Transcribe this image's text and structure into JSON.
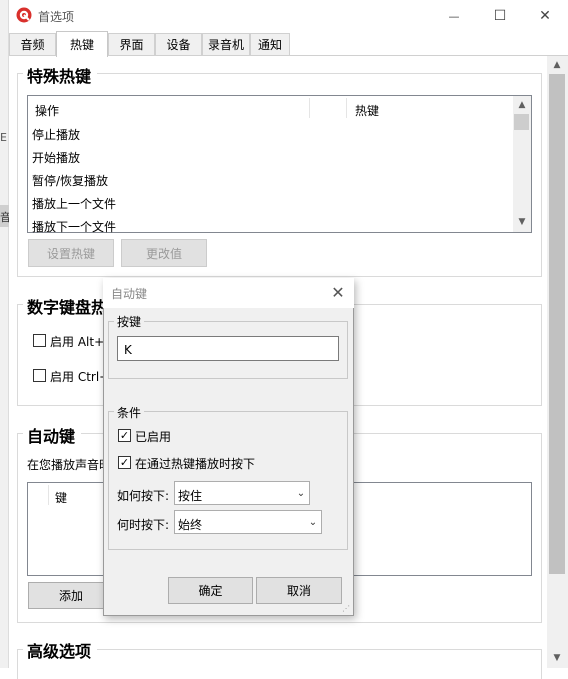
{
  "window": {
    "title": "首选项",
    "controls": {
      "minimize": "—",
      "maximize": "☐",
      "close": "✕"
    }
  },
  "tabs": [
    {
      "label": "音频",
      "active": false
    },
    {
      "label": "热键",
      "active": true
    },
    {
      "label": "界面",
      "active": false
    },
    {
      "label": "设备",
      "active": false
    },
    {
      "label": "录音机",
      "active": false
    },
    {
      "label": "通知",
      "active": false
    }
  ],
  "special_hotkeys": {
    "title": "特殊热键",
    "columns": [
      "操作",
      "热键"
    ],
    "rows": [
      "停止播放",
      "开始播放",
      "暂停/恢复播放",
      "播放上一个文件",
      "播放下一个文件"
    ],
    "set_button": "设置热键",
    "change_button": "更改值"
  },
  "numpad_hotkeys": {
    "title": "数字键盘热",
    "options": [
      {
        "label": "启用 Alt+",
        "checked": false
      },
      {
        "label": "启用 Ctrl+",
        "checked": false
      }
    ]
  },
  "auto_keys": {
    "title": "自动键",
    "description": "在您播放声音时",
    "column": "键",
    "add_button": "添加"
  },
  "advanced": {
    "title": "高级选项"
  },
  "dialog": {
    "title": "自动键",
    "key_group": "按键",
    "key_value": "K",
    "cond_group": "条件",
    "enabled_label": "已启用",
    "enabled_checked": true,
    "via_hotkey_label": "在通过热键播放时按下",
    "via_hotkey_checked": true,
    "how_label": "如何按下:",
    "how_value": "按住",
    "when_label": "何时按下:",
    "when_value": "始终",
    "ok": "确定",
    "cancel": "取消"
  },
  "background": {
    "edge_letter": "E",
    "edge_text": "音"
  },
  "colors": {
    "app_icon": "#d9302c",
    "accent": "#0078d7"
  }
}
